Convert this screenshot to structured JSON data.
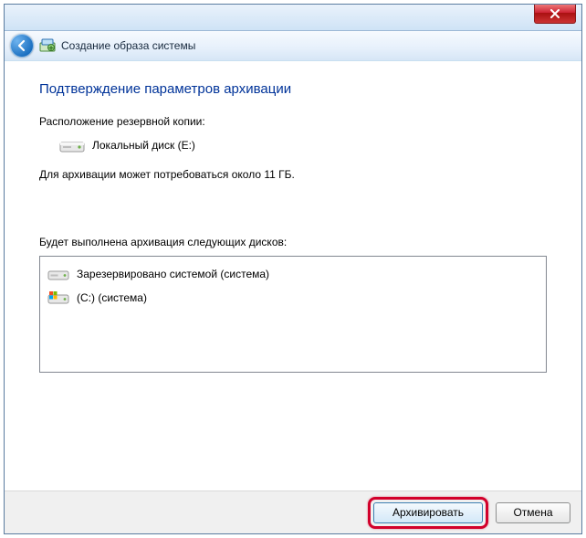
{
  "window": {
    "title": "Создание образа системы"
  },
  "page": {
    "heading": "Подтверждение параметров архивации",
    "location_label": "Расположение резервной копии:",
    "destination": "Локальный диск (E:)",
    "size_note": "Для архивации может потребоваться около 11 ГБ.",
    "drives_label": "Будет выполнена архивация следующих дисков:",
    "drives": [
      {
        "label": "Зарезервировано системой (система)",
        "icon": "hdd"
      },
      {
        "label": "(C:) (система)",
        "icon": "windrive"
      }
    ]
  },
  "footer": {
    "primary": "Архивировать",
    "cancel": "Отмена"
  },
  "icons": {
    "back": "back-arrow",
    "close": "close-x",
    "app": "backup-wizard"
  }
}
